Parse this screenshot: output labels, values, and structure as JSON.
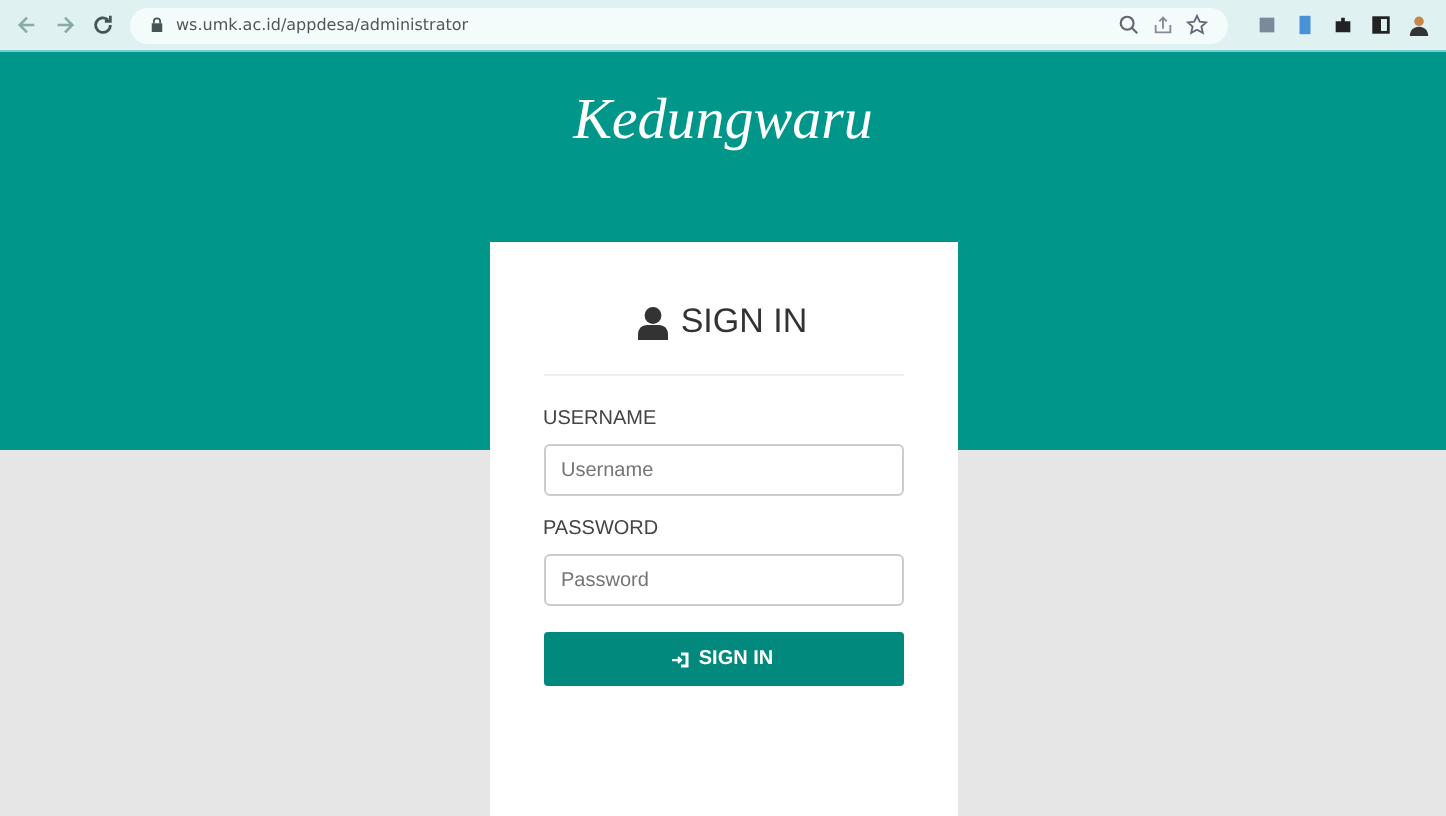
{
  "browser": {
    "url": "ws.umk.ac.id/appdesa/administrator"
  },
  "site_title": "Kedungwaru",
  "login": {
    "heading": "SIGN IN",
    "fields": [
      {
        "label": "USERNAME",
        "placeholder": "Username"
      },
      {
        "label": "PASSWORD",
        "placeholder": "Password"
      }
    ],
    "button": "SIGN IN"
  }
}
